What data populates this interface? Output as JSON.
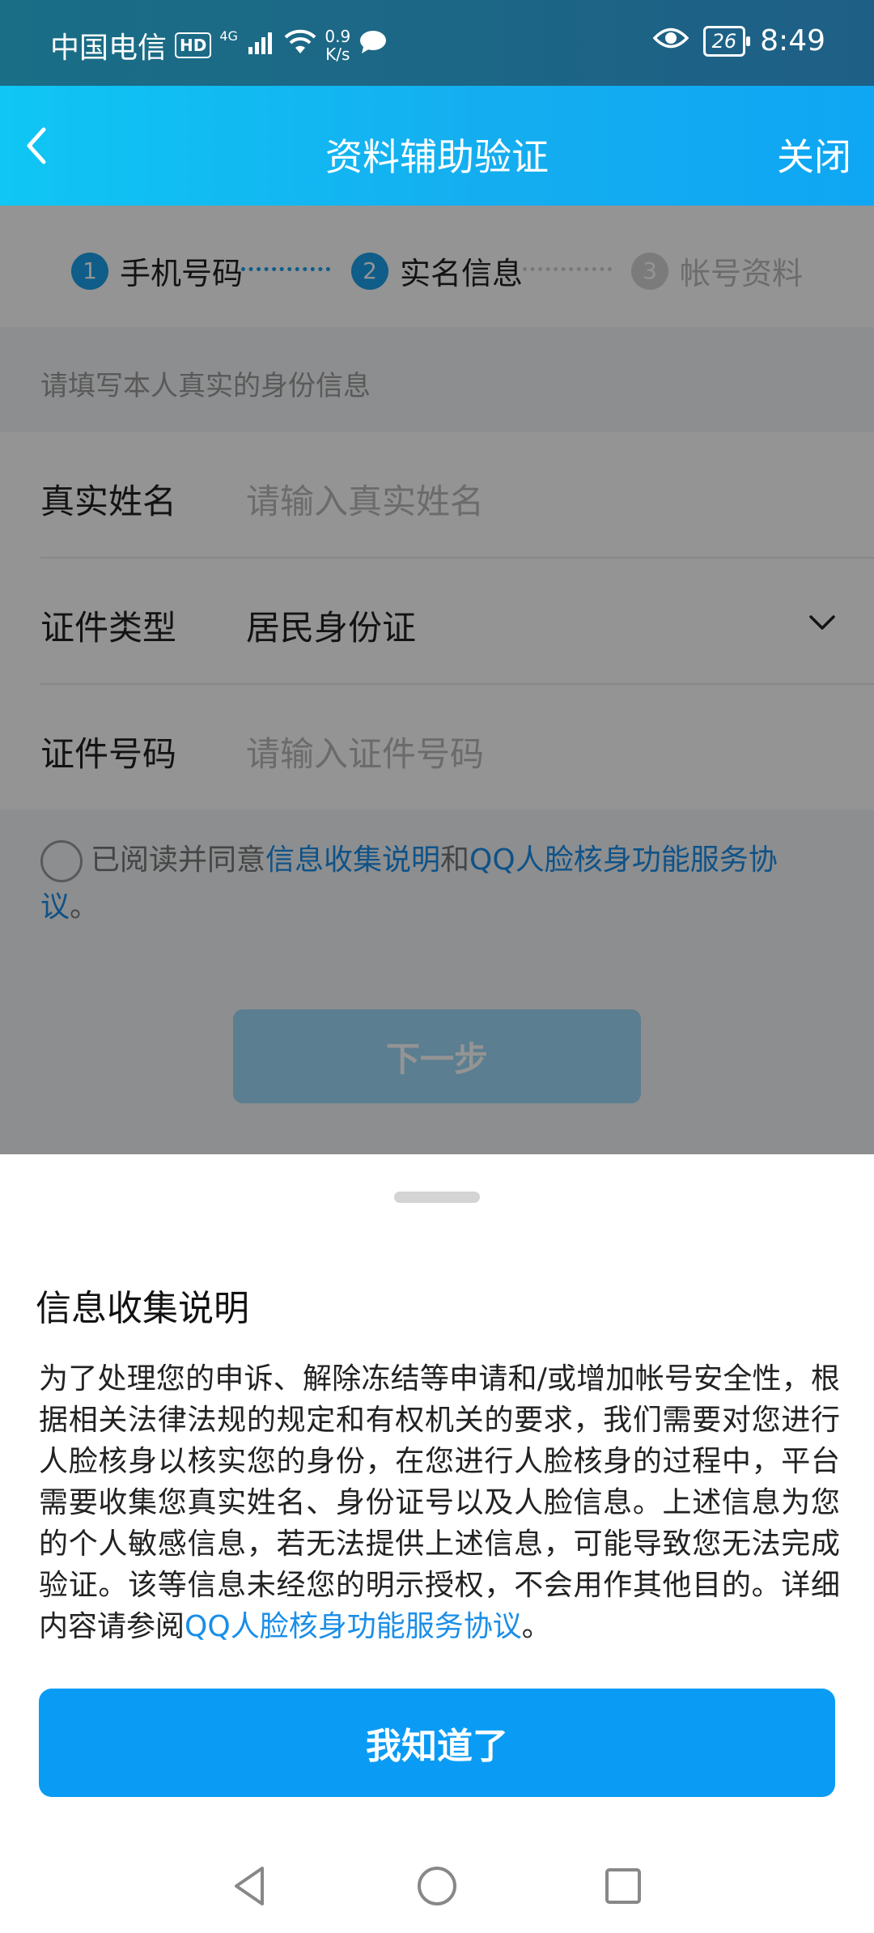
{
  "status_bar": {
    "carrier": "中国电信",
    "hd": "HD",
    "network": "4G",
    "speed_value": "0.9",
    "speed_unit": "K/s",
    "battery": "26",
    "time": "8:49"
  },
  "nav": {
    "title": "资料辅助验证",
    "close_label": "关闭"
  },
  "steps": [
    {
      "num": "1",
      "label": "手机号码"
    },
    {
      "num": "2",
      "label": "实名信息"
    },
    {
      "num": "3",
      "label": "帐号资料"
    }
  ],
  "form": {
    "hint": "请填写本人真实的身份信息",
    "name_label": "真实姓名",
    "name_placeholder": "请输入真实姓名",
    "id_type_label": "证件类型",
    "id_type_value": "居民身份证",
    "id_number_label": "证件号码",
    "id_number_placeholder": "请输入证件号码"
  },
  "agreement": {
    "prefix": "已阅读并同意",
    "link1": "信息收集说明",
    "conj": "和",
    "link2": "QQ人脸核身功能服务协议",
    "suffix": "。"
  },
  "next_button": "下一步",
  "sheet": {
    "title": "信息收集说明",
    "body": "为了处理您的申诉、解除冻结等申请和/或增加帐号安全性，根据相关法律法规的规定和有权机关的要求，我们需要对您进行人脸核身以核实您的身份，在您进行人脸核身的过程中，平台需要收集您真实姓名、身份证号以及人脸信息。上述信息为您的个人敏感信息，若无法提供上述信息，可能导致您无法完成验证。该等信息未经您的明示授权，不会用作其他目的。详细内容请参阅",
    "link": "QQ人脸核身功能服务协议",
    "suffix": "。",
    "ok_button": "我知道了"
  },
  "icons": {
    "back": "chevron-left-icon",
    "dropdown": "chevron-down-icon",
    "wifi": "wifi-icon",
    "signal": "signal-icon",
    "message": "message-icon",
    "eye": "eye-icon"
  }
}
